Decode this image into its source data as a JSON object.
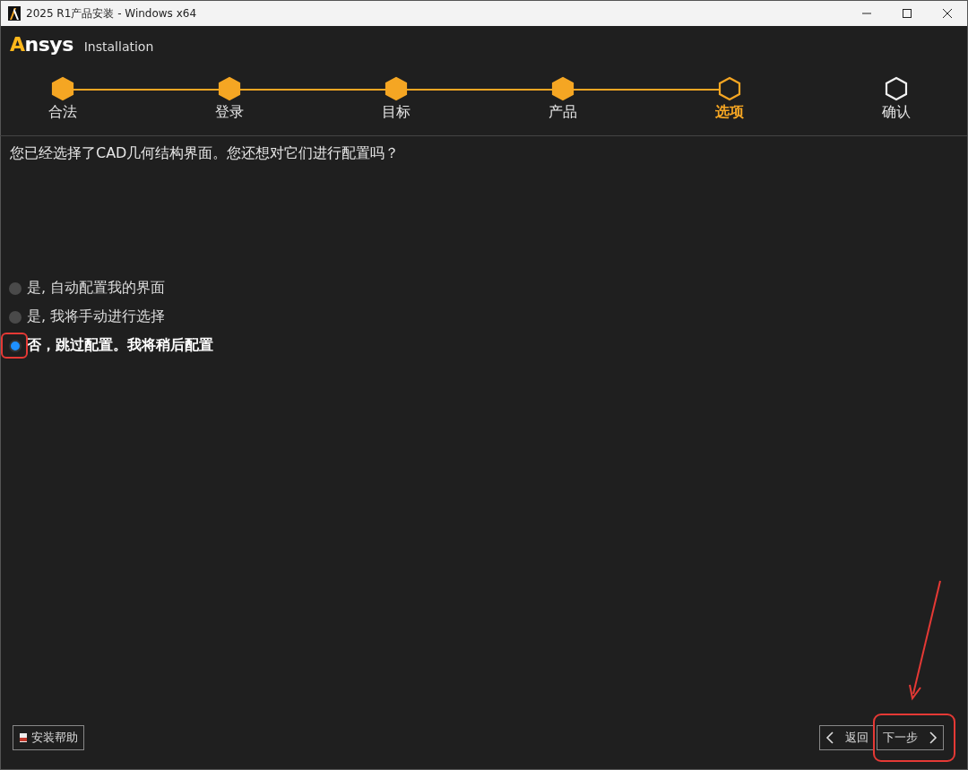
{
  "window": {
    "title": "2025 R1产品安装 - Windows x64"
  },
  "header": {
    "brand": "Ansys",
    "subtitle": "Installation"
  },
  "steps": [
    {
      "label": "合法",
      "completed": true,
      "selected": false
    },
    {
      "label": "登录",
      "completed": true,
      "selected": false
    },
    {
      "label": "目标",
      "completed": true,
      "selected": false
    },
    {
      "label": "产品",
      "completed": true,
      "selected": false
    },
    {
      "label": "选项",
      "completed": false,
      "selected": true
    },
    {
      "label": "确认",
      "completed": false,
      "selected": false
    }
  ],
  "question": "您已经选择了CAD几何结构界面。您还想对它们进行配置吗？",
  "options": [
    {
      "label": "是, 自动配置我的界面",
      "selected": false
    },
    {
      "label": "是, 我将手动进行选择",
      "selected": false
    },
    {
      "label": "否，跳过配置。我将稍后配置",
      "selected": true
    }
  ],
  "footer": {
    "help": "安装帮助",
    "back": "返回",
    "next": "下一步"
  }
}
